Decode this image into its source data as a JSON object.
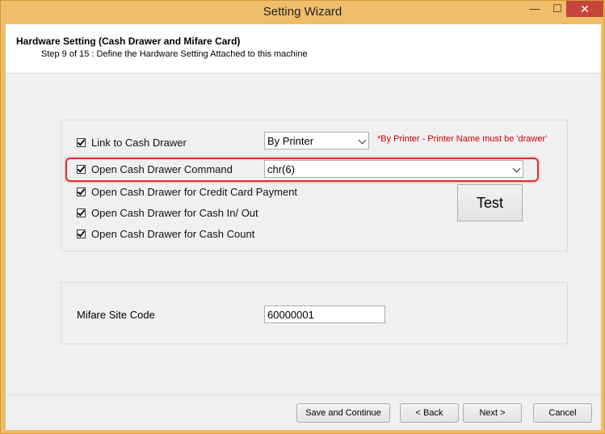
{
  "window": {
    "title": "Setting Wizard",
    "controls": {
      "minimize": "—",
      "maximize": "☐",
      "close": "✕"
    }
  },
  "header": {
    "title": "Hardware Setting (Cash Drawer and Mifare Card)",
    "subtitle": "Step 9 of 15 : Define the Hardware Setting Attached to this machine"
  },
  "cash_drawer": {
    "options": [
      {
        "label": "Link to Cash Drawer",
        "checked": true
      },
      {
        "label": "Open Cash Drawer Command",
        "checked": true
      },
      {
        "label": "Open Cash Drawer for Credit Card Payment",
        "checked": true
      },
      {
        "label": "Open Cash Drawer for Cash In/ Out",
        "checked": true
      },
      {
        "label": "Open Cash Drawer for Cash Count",
        "checked": true
      }
    ],
    "link_select_value": "By Printer",
    "command_select_value": "chr(6)",
    "note": "*By Printer - Printer Name must be 'drawer'",
    "test_label": "Test",
    "highlight_color": "#e03030"
  },
  "mifare": {
    "label": "Mifare Site Code",
    "value": "60000001"
  },
  "footer": {
    "save_label": "Save and Continue",
    "back_label": "< Back",
    "next_label": "Next >",
    "cancel_label": "Cancel"
  }
}
